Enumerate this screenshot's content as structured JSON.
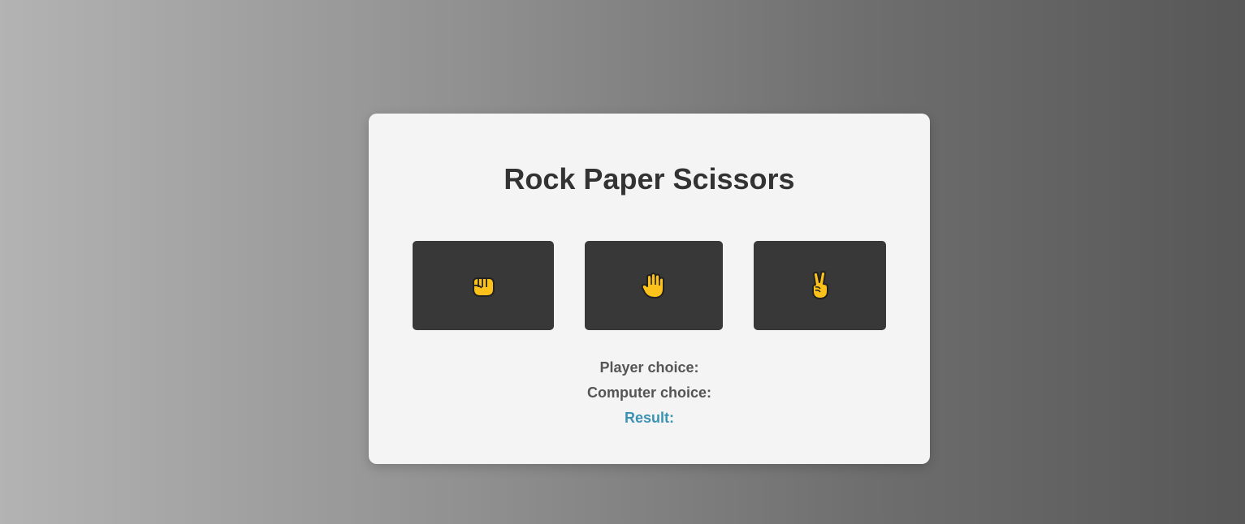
{
  "app": {
    "title": "Rock Paper Scissors"
  },
  "choices": [
    {
      "name": "rock",
      "icon": "fist-icon"
    },
    {
      "name": "paper",
      "icon": "raised-hand-icon"
    },
    {
      "name": "scissors",
      "icon": "victory-hand-icon"
    }
  ],
  "status": {
    "player_label": "Player choice:",
    "player_value": "",
    "computer_label": "Computer choice:",
    "computer_value": "",
    "result_label": "Result:",
    "result_value": ""
  },
  "colors": {
    "card_background": "#f4f4f4",
    "button_background": "#383838",
    "title_text": "#333333",
    "label_text": "#555555",
    "result_text": "#3a93b3",
    "emoji_fill": "#fcc21b"
  }
}
